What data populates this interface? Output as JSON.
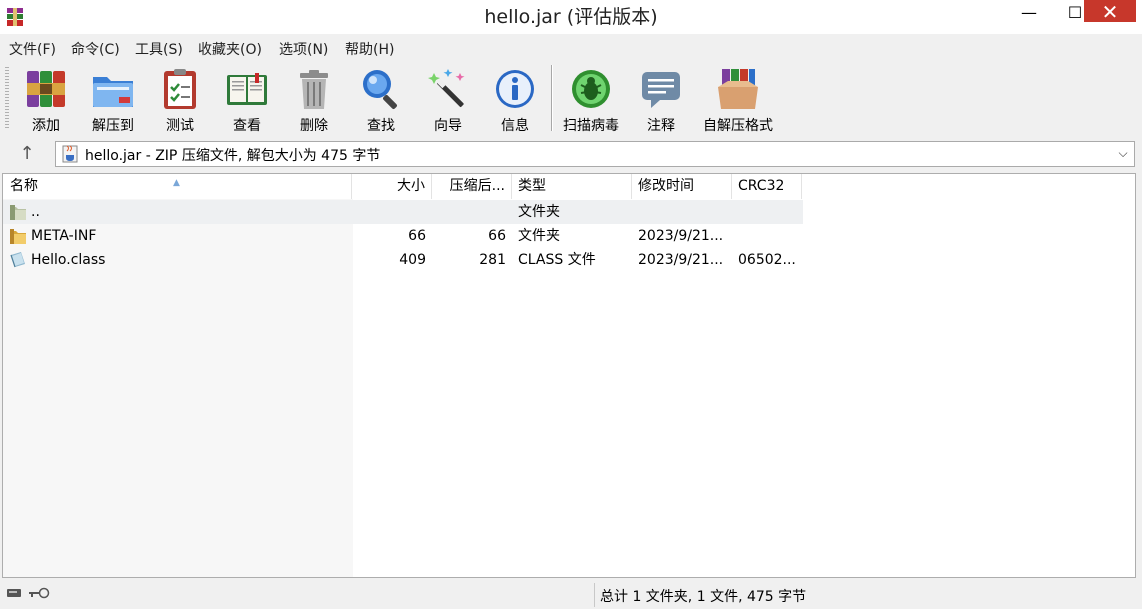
{
  "window": {
    "title": "hello.jar (评估版本)",
    "minimize": "—",
    "maximize": "☐",
    "close": "✕"
  },
  "menu": [
    {
      "label": "文件(F)"
    },
    {
      "label": "命令(C)"
    },
    {
      "label": "工具(S)"
    },
    {
      "label": "收藏夹(O)"
    },
    {
      "label": "选项(N)"
    },
    {
      "label": "帮助(H)"
    }
  ],
  "toolbar": [
    {
      "label": "添加",
      "icon": "books-add-icon"
    },
    {
      "label": "解压到",
      "icon": "folder-extract-icon"
    },
    {
      "label": "测试",
      "icon": "clipboard-test-icon"
    },
    {
      "label": "查看",
      "icon": "book-view-icon"
    },
    {
      "label": "删除",
      "icon": "trash-can-icon"
    },
    {
      "label": "查找",
      "icon": "magnifier-icon"
    },
    {
      "label": "向导",
      "icon": "magic-wand-icon"
    },
    {
      "label": "信息",
      "icon": "info-icon"
    },
    {
      "label": "扫描病毒",
      "icon": "virus-scan-icon"
    },
    {
      "label": "注释",
      "icon": "comment-icon"
    },
    {
      "label": "自解压格式",
      "icon": "sfx-box-icon"
    }
  ],
  "address": {
    "up": "↑",
    "text": "hello.jar - ZIP 压缩文件, 解包大小为 475 字节",
    "dropdown": "⌵"
  },
  "columns": {
    "name": "名称",
    "size": "大小",
    "packed": "压缩后...",
    "type": "类型",
    "modified": "修改时间",
    "crc": "CRC32"
  },
  "rows": [
    {
      "name": "..",
      "size": "",
      "packed": "",
      "type": "文件夹",
      "modified": "",
      "crc": "",
      "icon": "parent-folder-icon"
    },
    {
      "name": "META-INF",
      "size": "66",
      "packed": "66",
      "type": "文件夹",
      "modified": "2023/9/21...",
      "crc": "",
      "icon": "folder-icon"
    },
    {
      "name": "Hello.class",
      "size": "409",
      "packed": "281",
      "type": "CLASS 文件",
      "modified": "2023/9/21...",
      "crc": "06502...",
      "icon": "file-icon"
    }
  ],
  "status": {
    "text": "总计 1 文件夹, 1 文件, 475 字节"
  }
}
